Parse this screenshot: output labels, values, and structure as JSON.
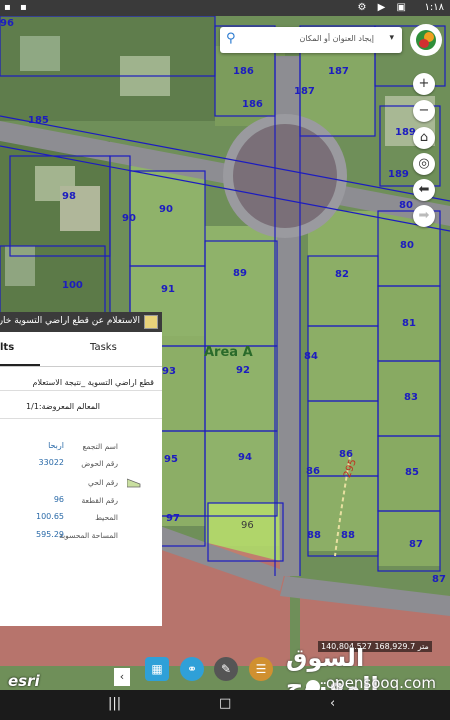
{
  "status_bar": {
    "time": "١:١٨",
    "icons": "⚙ ▶ ▣"
  },
  "search": {
    "placeholder": "إيجاد العنوان أو المكان"
  },
  "map": {
    "parcel_labels": [
      "96",
      "186",
      "187",
      "185",
      "186",
      "187",
      "189",
      "189",
      "98",
      "90",
      "90",
      "80",
      "80",
      "89",
      "82",
      "100",
      "91",
      "81",
      "93",
      "92",
      "84",
      "83",
      "95",
      "94",
      "86",
      "86",
      "85",
      "97",
      "96",
      "88",
      "88",
      "87",
      "87"
    ],
    "area_label": "Area A",
    "road_label": "295"
  },
  "panel": {
    "title": "الاستعلام عن قطع اراضي التسوية خارج",
    "tab_results": "lts",
    "tab_tasks": "Tasks",
    "result_title": "قطع اراضي التسوية _نتيجة الاستعلام",
    "features_shown": "المعالم المعروضة:1/1",
    "fields": [
      {
        "key": "اسم التجمع",
        "value": "اربحا"
      },
      {
        "key": "رقم الحوض",
        "value": "33022"
      },
      {
        "key": "رقم الحي",
        "value": ""
      },
      {
        "key": "رقم القطعة",
        "value": "96"
      },
      {
        "key": "المحيط",
        "value": "100.65"
      },
      {
        "key": "المساحة المحسوبة",
        "value": "595.29"
      }
    ]
  },
  "footer": {
    "esri": "esri",
    "coords": "140,804.527 168,929.7 متر"
  },
  "watermark": {
    "arabic": "السوق المفتوح",
    "english": "opensooq.com"
  },
  "colors": {
    "parcel_line": "#1c1cc0",
    "road": "#8f8f94",
    "grass": "#7fa860",
    "selected": "#a8d060",
    "red_zone": "#c86060"
  }
}
